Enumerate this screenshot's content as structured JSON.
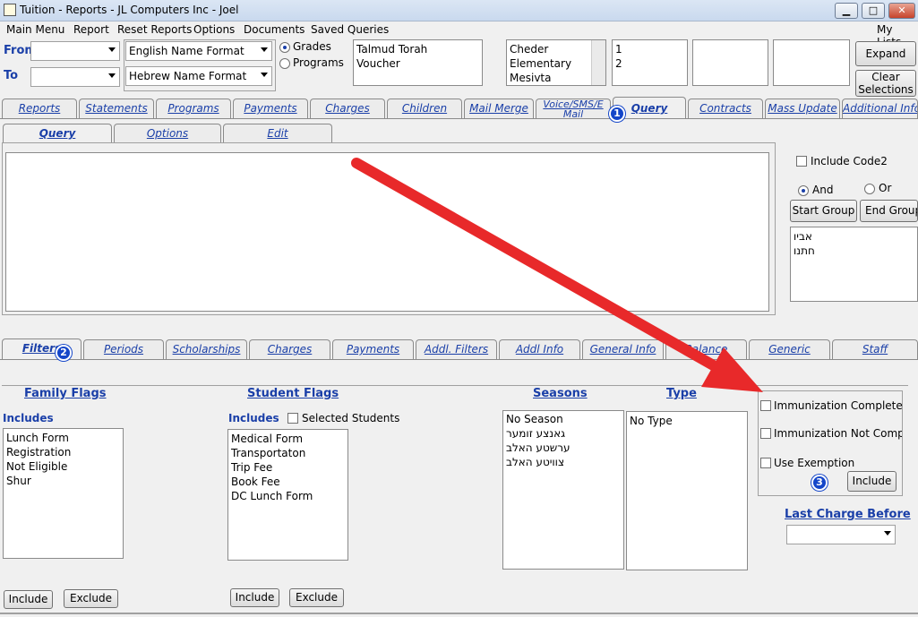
{
  "window": {
    "title": "Tuition - Reports - JL Computers Inc - Joel",
    "min": "▁",
    "max": "□",
    "close": "✕"
  },
  "menu": {
    "items": [
      "Main Menu",
      "Report",
      "Reset Reports",
      "Options",
      "Documents",
      "Saved Queries"
    ],
    "right": "My Lists"
  },
  "top": {
    "from_label": "From",
    "to_label": "To",
    "english_format": "English Name Format",
    "hebrew_format": "Hebrew Name Format",
    "grades_label": "Grades",
    "programs_label": "Programs",
    "schools": [
      "Talmud Torah",
      "Voucher"
    ],
    "levels": [
      "Cheder",
      "Elementary",
      "Mesivta"
    ],
    "nums": [
      "1",
      "2"
    ],
    "expand": "Expand",
    "clear": "Clear\nSelections"
  },
  "main_tabs": [
    "Reports",
    "Statements",
    "Programs",
    "Payments",
    "Charges",
    "Children",
    "Mail Merge",
    "Voice/SMS/E Mail",
    "Query",
    "Contracts",
    "Mass Update",
    "Additional Info"
  ],
  "query_tabs": [
    "Query",
    "Options",
    "Edit"
  ],
  "right_panel": {
    "include_code2": "Include Code2",
    "and": "And",
    "or": "Or",
    "start_group": "Start Group",
    "end_group": "End Group",
    "list": [
      "אביו",
      "חתנו"
    ]
  },
  "filter_tabs": [
    "Filters",
    "Periods",
    "Scholarships",
    "Charges",
    "Payments",
    "Addl. Filters",
    "Addl Info",
    "General Info",
    "Balance",
    "Generic",
    "Staff"
  ],
  "filters": {
    "family_flags": "Family Flags",
    "student_flags": "Student Flags",
    "seasons": "Seasons",
    "type": "Type",
    "includes": "Includes",
    "selected_students": "Selected Students",
    "family_list": [
      "Lunch Form",
      "Registration",
      "Not Eligible",
      "Shur"
    ],
    "student_list": [
      "Medical Form",
      "Transportaton",
      "Trip Fee",
      "Book Fee",
      "DC Lunch Form"
    ],
    "season_list": [
      "No Season",
      "גאנצע זומער",
      "ערשטע האלב",
      "צוויטע האלב"
    ],
    "type_list": [
      "No Type"
    ],
    "immunization_complete": "Immunization Complete",
    "immunization_not_complete": "Immunization Not Complete",
    "use_exemption": "Use Exemption",
    "include": "Include",
    "exclude": "Exclude",
    "last_charge_before": "Last Charge Before"
  },
  "badges": [
    "1",
    "2",
    "3"
  ],
  "colors": {
    "accent": "#1a3fa8",
    "arrow": "#e8292a",
    "badge": "#1446c9"
  }
}
